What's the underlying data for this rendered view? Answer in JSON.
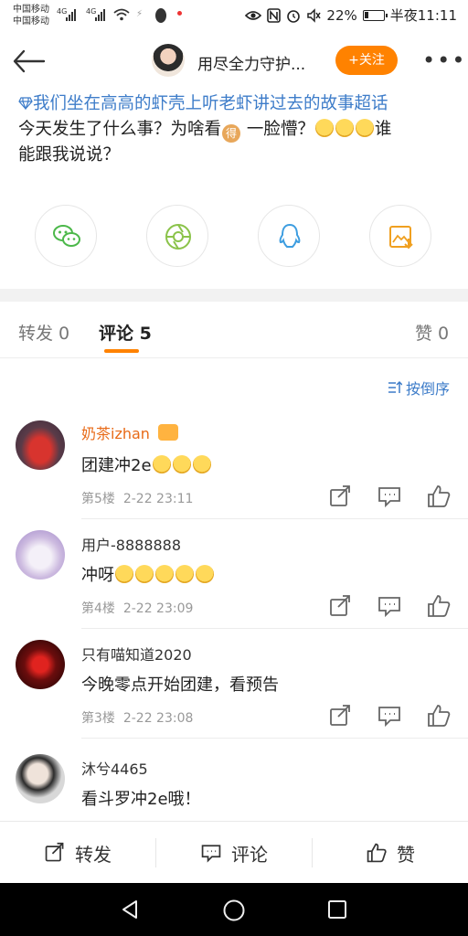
{
  "status_bar": {
    "carrier_1": "中国移动",
    "carrier_2": "中国移动",
    "net_1": "4G",
    "net_2": "4G",
    "battery": "22%",
    "battery_level": 0.22,
    "time": "半夜11:11",
    "icons": [
      "eye-icon",
      "nfc-icon",
      "alarm-icon",
      "mute-icon",
      "battery-icon",
      "wifi-icon",
      "signal-icon"
    ]
  },
  "header": {
    "title": "用尽全力守护...",
    "follow_label": "+关注",
    "more_label": "•••"
  },
  "post": {
    "topic": "我们坐在高高的虾壳上听老虾讲过去的故事超话",
    "body_1": "今天发生了什么事？为啥看",
    "inline_badge": "得",
    "body_2": " 一脸懵？",
    "body_3": "谁",
    "body_4": "能跟我说说？"
  },
  "share_targets": [
    "wechat",
    "moments",
    "qq",
    "save-image"
  ],
  "tabs": {
    "repost": "转发 0",
    "comments": "评论 5",
    "likes": "赞 0"
  },
  "sort_label": "按倒序",
  "comments": [
    {
      "name": "奶茶izhan",
      "text": "团建冲2e",
      "floor": "第5楼",
      "time": "2-22 23:11",
      "name_color": "#e86a17"
    },
    {
      "name": "用户-8888888",
      "text": "冲呀",
      "floor": "第4楼",
      "time": "2-22 23:09",
      "name_color": "#333333"
    },
    {
      "name": "只有喵知道2020",
      "text": "今晚零点开始团建，看预告",
      "floor": "第3楼",
      "time": "2-22 23:08",
      "name_color": "#333333"
    },
    {
      "name": "沐兮4465",
      "text": "看斗罗冲2e哦！",
      "floor": "",
      "time": "",
      "name_color": "#333333"
    }
  ],
  "actions": {
    "repost": "转发",
    "comment": "评论",
    "like": "赞"
  },
  "colors": {
    "accent": "#ff8200",
    "link": "#3d7cc9",
    "muted": "#999999"
  }
}
